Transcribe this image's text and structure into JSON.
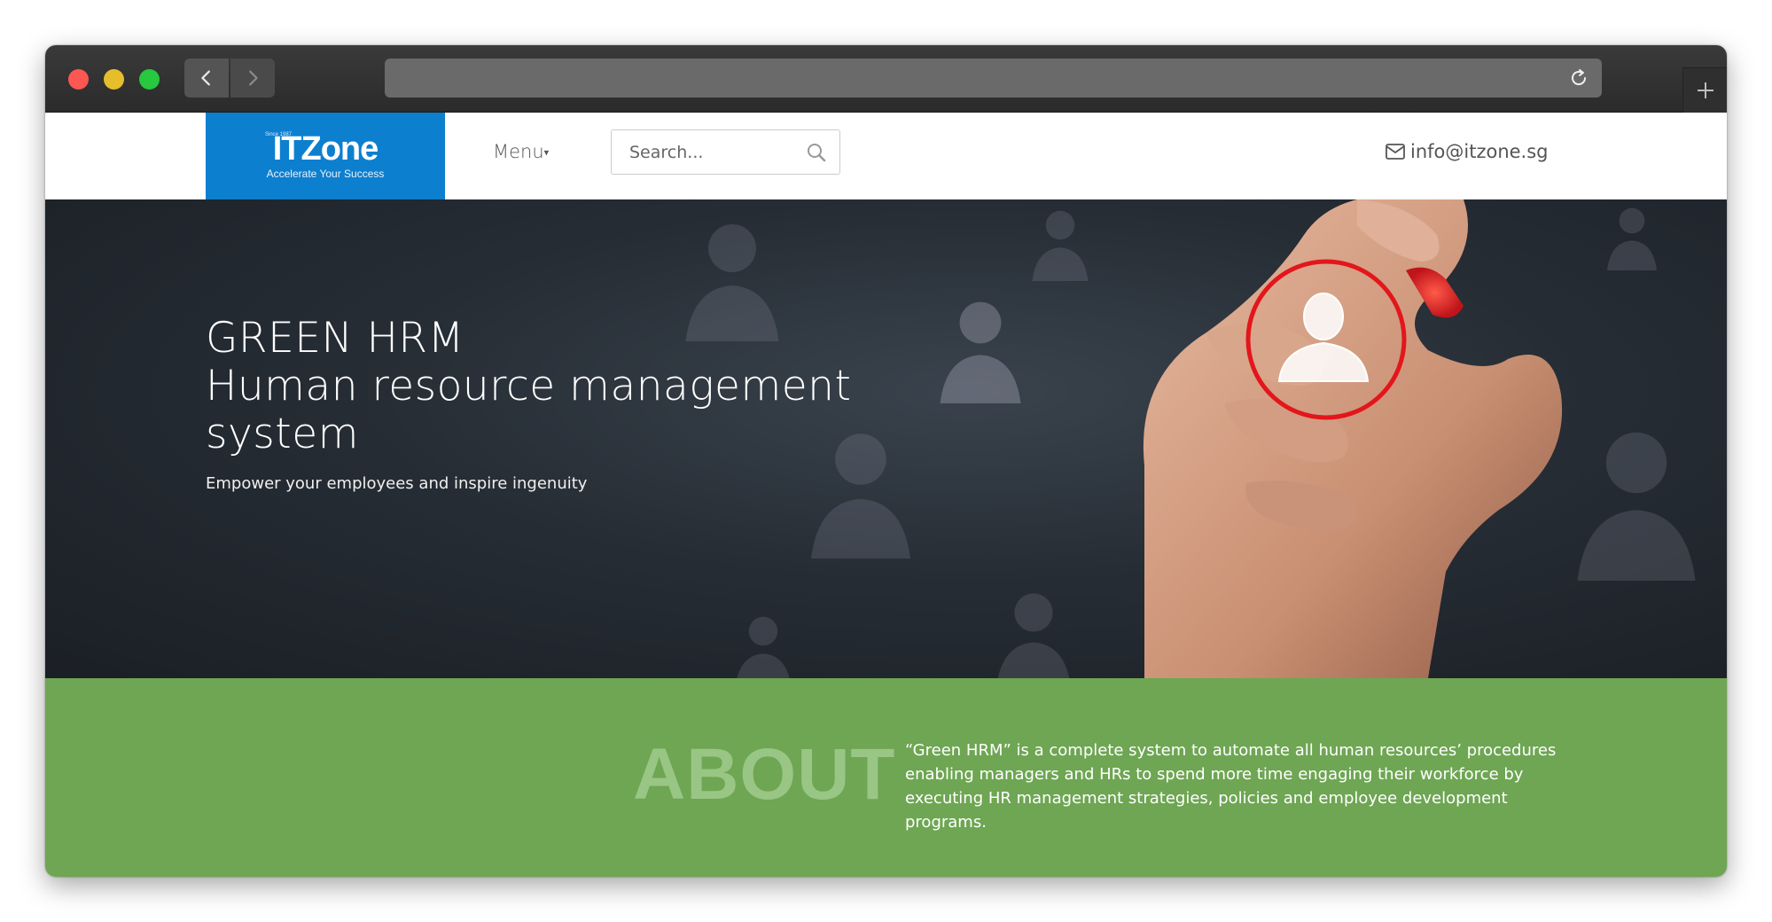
{
  "browser": {
    "url": ""
  },
  "header": {
    "logo": {
      "since": "Since 1987",
      "brand": "ITZone",
      "tagline": "Accelerate Your Success"
    },
    "menu_label": "Menu",
    "search_placeholder": "Search...",
    "email": "info@itzone.sg"
  },
  "hero": {
    "title_line1": "GREEN HRM",
    "title_line2": "Human resource management",
    "title_line3": "system",
    "subtitle": "Empower your employees and inspire ingenuity"
  },
  "about": {
    "heading": "ABOUT",
    "line1": "“Green HRM” is a complete system to automate all human resources’ procedures",
    "line2": "enabling managers and HRs to spend more time engaging their workforce by",
    "line3": "executing HR management strategies, policies and employee development programs."
  },
  "colors": {
    "logo_bg": "#0d7fcf",
    "about_bg": "#6ea653",
    "about_heading": "#99c684",
    "hero_bg": "#262d35",
    "circle": "#e3161b"
  }
}
